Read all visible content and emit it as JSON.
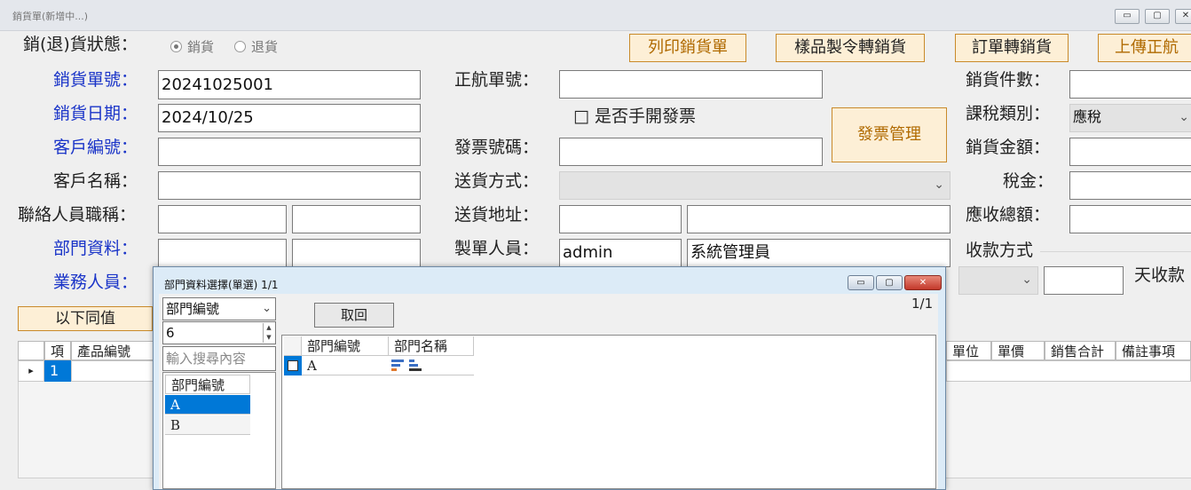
{
  "window": {
    "title": "銷貨單(新增中...)",
    "minimize": "▭",
    "maximize": "▢",
    "close": "✕"
  },
  "status": {
    "label": "銷(退)貨狀態：",
    "options": [
      "銷貨",
      "退貨"
    ],
    "selected": "銷貨"
  },
  "top_buttons": [
    "列印銷貨單",
    "樣品製令轉銷貨",
    "訂單轉銷貨",
    "上傳正航"
  ],
  "left_form": {
    "sales_no": {
      "label": "銷貨單號：",
      "value": "20241025001"
    },
    "sales_date": {
      "label": "銷貨日期：",
      "value": "2024/10/25"
    },
    "customer_no": {
      "label": "客戶編號：",
      "value": ""
    },
    "customer_name": {
      "label": "客戶名稱：",
      "value": ""
    },
    "contact_title": {
      "label": "聯絡人員職稱：",
      "value1": "",
      "value2": ""
    },
    "dept": {
      "label": "部門資料：",
      "value1": "",
      "value2": ""
    },
    "salesman": {
      "label": "業務人員："
    }
  },
  "mid_form": {
    "zhenghang_no": {
      "label": "正航單號：",
      "value": ""
    },
    "manual_invoice": {
      "label": "是否手開發票",
      "checkbox": "□"
    },
    "invoice_no": {
      "label": "發票號碼：",
      "value": ""
    },
    "delivery_method": {
      "label": "送貨方式：",
      "value": ""
    },
    "delivery_address": {
      "label": "送貨地址：",
      "value1": "",
      "value2": ""
    },
    "creator": {
      "label": "製單人員：",
      "id": "admin",
      "name": "系統管理員"
    }
  },
  "invoice_mgmt_button": "發票管理",
  "right_form": {
    "qty": {
      "label": "銷貨件數：",
      "value": ""
    },
    "tax_type": {
      "label": "課稅類別：",
      "value": "應稅"
    },
    "amount": {
      "label": "銷貨金額：",
      "value": ""
    },
    "tax": {
      "label": "稅金：",
      "value": ""
    },
    "total": {
      "label": "應收總額：",
      "value": ""
    },
    "payment": {
      "label": "收款方式",
      "days_suffix": "天收款"
    }
  },
  "same_below_button": "以下同值",
  "grid": {
    "left_headers": [
      "項",
      "產品編號"
    ],
    "right_headers": [
      "單位",
      "單價",
      "銷售合計",
      "備註事項"
    ],
    "rows": [
      {
        "item": "1"
      }
    ]
  },
  "dialog": {
    "title": "部門資料選擇(單選) 1/1",
    "search_field": "部門編號",
    "search_count": "6",
    "search_placeholder": "輸入搜尋內容",
    "list_header": "部門編號",
    "list_items": [
      "A",
      "B"
    ],
    "selected_item": "A",
    "fetch_button": "取回",
    "page_indicator": "1/1",
    "table_headers": [
      "部門編號",
      "部門名稱"
    ],
    "table_rows": [
      {
        "code": "A",
        "name": ""
      }
    ]
  },
  "icons": {
    "dropdown": "⌄",
    "row_pointer": "▸"
  }
}
